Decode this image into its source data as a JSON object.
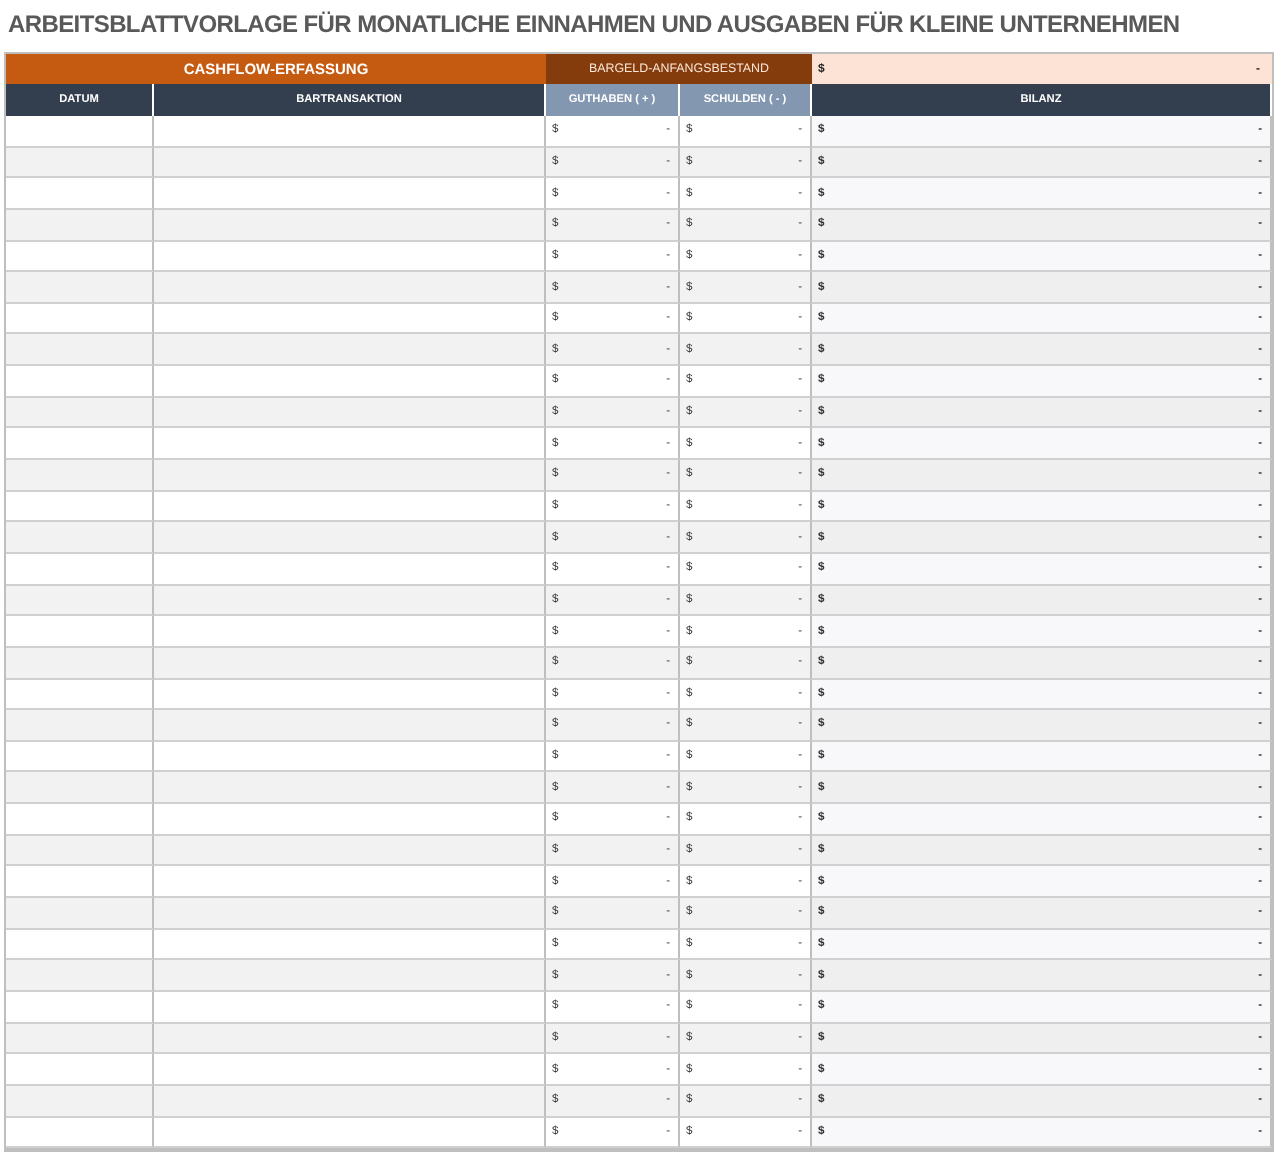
{
  "title": "ARBEITSBLATTVORLAGE FÜR MONATLICHE EINNAHMEN UND AUSGABEN FÜR KLEINE UNTERNEHMEN",
  "section_label": "CASHFLOW-ERFASSUNG",
  "opening_balance": {
    "label": "BARGELD-ANFANGSBESTAND",
    "currency": "$",
    "value": "-"
  },
  "columns": [
    {
      "kind": "dark",
      "label": "DATUM"
    },
    {
      "kind": "dark",
      "label": "BARTRANSAKTION"
    },
    {
      "kind": "light",
      "label": "GUTHABEN ( + )"
    },
    {
      "kind": "light",
      "label": "SCHULDEN ( - )"
    },
    {
      "kind": "dark",
      "label": "BILANZ"
    }
  ],
  "rows": [
    {
      "credit": {
        "currency": "$",
        "value": "-"
      },
      "debit": {
        "currency": "$",
        "value": "-"
      },
      "balance": {
        "currency": "$",
        "value": "-"
      }
    },
    {
      "credit": {
        "currency": "$",
        "value": "-"
      },
      "debit": {
        "currency": "$",
        "value": "-"
      },
      "balance": {
        "currency": "$",
        "value": "-"
      }
    },
    {
      "credit": {
        "currency": "$",
        "value": "-"
      },
      "debit": {
        "currency": "$",
        "value": "-"
      },
      "balance": {
        "currency": "$",
        "value": "-"
      }
    },
    {
      "credit": {
        "currency": "$",
        "value": "-"
      },
      "debit": {
        "currency": "$",
        "value": "-"
      },
      "balance": {
        "currency": "$",
        "value": "-"
      }
    },
    {
      "credit": {
        "currency": "$",
        "value": "-"
      },
      "debit": {
        "currency": "$",
        "value": "-"
      },
      "balance": {
        "currency": "$",
        "value": "-"
      }
    },
    {
      "credit": {
        "currency": "$",
        "value": "-"
      },
      "debit": {
        "currency": "$",
        "value": "-"
      },
      "balance": {
        "currency": "$",
        "value": "-"
      }
    },
    {
      "credit": {
        "currency": "$",
        "value": "-"
      },
      "debit": {
        "currency": "$",
        "value": "-"
      },
      "balance": {
        "currency": "$",
        "value": "-"
      }
    },
    {
      "credit": {
        "currency": "$",
        "value": "-"
      },
      "debit": {
        "currency": "$",
        "value": "-"
      },
      "balance": {
        "currency": "$",
        "value": "-"
      }
    },
    {
      "credit": {
        "currency": "$",
        "value": "-"
      },
      "debit": {
        "currency": "$",
        "value": "-"
      },
      "balance": {
        "currency": "$",
        "value": "-"
      }
    },
    {
      "credit": {
        "currency": "$",
        "value": "-"
      },
      "debit": {
        "currency": "$",
        "value": "-"
      },
      "balance": {
        "currency": "$",
        "value": "-"
      }
    },
    {
      "credit": {
        "currency": "$",
        "value": "-"
      },
      "debit": {
        "currency": "$",
        "value": "-"
      },
      "balance": {
        "currency": "$",
        "value": "-"
      }
    },
    {
      "credit": {
        "currency": "$",
        "value": "-"
      },
      "debit": {
        "currency": "$",
        "value": "-"
      },
      "balance": {
        "currency": "$",
        "value": "-"
      }
    },
    {
      "credit": {
        "currency": "$",
        "value": "-"
      },
      "debit": {
        "currency": "$",
        "value": "-"
      },
      "balance": {
        "currency": "$",
        "value": "-"
      }
    },
    {
      "credit": {
        "currency": "$",
        "value": "-"
      },
      "debit": {
        "currency": "$",
        "value": "-"
      },
      "balance": {
        "currency": "$",
        "value": "-"
      }
    },
    {
      "credit": {
        "currency": "$",
        "value": "-"
      },
      "debit": {
        "currency": "$",
        "value": "-"
      },
      "balance": {
        "currency": "$",
        "value": "-"
      }
    },
    {
      "credit": {
        "currency": "$",
        "value": "-"
      },
      "debit": {
        "currency": "$",
        "value": "-"
      },
      "balance": {
        "currency": "$",
        "value": "-"
      }
    },
    {
      "credit": {
        "currency": "$",
        "value": "-"
      },
      "debit": {
        "currency": "$",
        "value": "-"
      },
      "balance": {
        "currency": "$",
        "value": "-"
      }
    },
    {
      "credit": {
        "currency": "$",
        "value": "-"
      },
      "debit": {
        "currency": "$",
        "value": "-"
      },
      "balance": {
        "currency": "$",
        "value": "-"
      }
    },
    {
      "credit": {
        "currency": "$",
        "value": "-"
      },
      "debit": {
        "currency": "$",
        "value": "-"
      },
      "balance": {
        "currency": "$",
        "value": "-"
      }
    },
    {
      "credit": {
        "currency": "$",
        "value": "-"
      },
      "debit": {
        "currency": "$",
        "value": "-"
      },
      "balance": {
        "currency": "$",
        "value": "-"
      }
    },
    {
      "credit": {
        "currency": "$",
        "value": "-"
      },
      "debit": {
        "currency": "$",
        "value": "-"
      },
      "balance": {
        "currency": "$",
        "value": "-"
      }
    },
    {
      "credit": {
        "currency": "$",
        "value": "-"
      },
      "debit": {
        "currency": "$",
        "value": "-"
      },
      "balance": {
        "currency": "$",
        "value": "-"
      }
    },
    {
      "credit": {
        "currency": "$",
        "value": "-"
      },
      "debit": {
        "currency": "$",
        "value": "-"
      },
      "balance": {
        "currency": "$",
        "value": "-"
      }
    },
    {
      "credit": {
        "currency": "$",
        "value": "-"
      },
      "debit": {
        "currency": "$",
        "value": "-"
      },
      "balance": {
        "currency": "$",
        "value": "-"
      }
    },
    {
      "credit": {
        "currency": "$",
        "value": "-"
      },
      "debit": {
        "currency": "$",
        "value": "-"
      },
      "balance": {
        "currency": "$",
        "value": "-"
      }
    },
    {
      "credit": {
        "currency": "$",
        "value": "-"
      },
      "debit": {
        "currency": "$",
        "value": "-"
      },
      "balance": {
        "currency": "$",
        "value": "-"
      }
    },
    {
      "credit": {
        "currency": "$",
        "value": "-"
      },
      "debit": {
        "currency": "$",
        "value": "-"
      },
      "balance": {
        "currency": "$",
        "value": "-"
      }
    },
    {
      "credit": {
        "currency": "$",
        "value": "-"
      },
      "debit": {
        "currency": "$",
        "value": "-"
      },
      "balance": {
        "currency": "$",
        "value": "-"
      }
    },
    {
      "credit": {
        "currency": "$",
        "value": "-"
      },
      "debit": {
        "currency": "$",
        "value": "-"
      },
      "balance": {
        "currency": "$",
        "value": "-"
      }
    },
    {
      "credit": {
        "currency": "$",
        "value": "-"
      },
      "debit": {
        "currency": "$",
        "value": "-"
      },
      "balance": {
        "currency": "$",
        "value": "-"
      }
    },
    {
      "credit": {
        "currency": "$",
        "value": "-"
      },
      "debit": {
        "currency": "$",
        "value": "-"
      },
      "balance": {
        "currency": "$",
        "value": "-"
      }
    },
    {
      "credit": {
        "currency": "$",
        "value": "-"
      },
      "debit": {
        "currency": "$",
        "value": "-"
      },
      "balance": {
        "currency": "$",
        "value": "-"
      }
    },
    {
      "credit": {
        "currency": "$",
        "value": "-"
      },
      "debit": {
        "currency": "$",
        "value": "-"
      },
      "balance": {
        "currency": "$",
        "value": "-"
      }
    }
  ]
}
